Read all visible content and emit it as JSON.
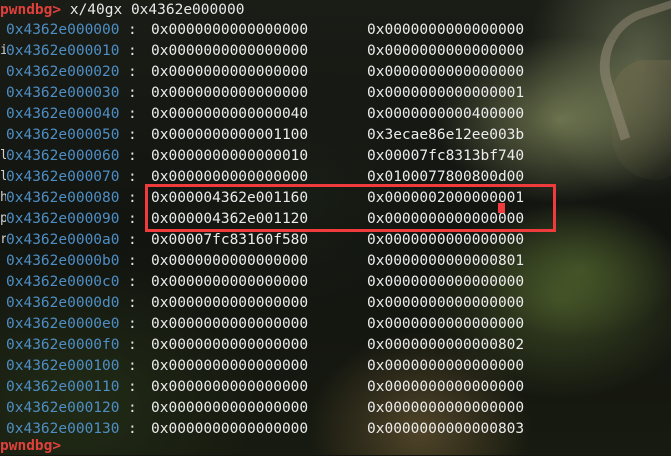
{
  "terminal": {
    "prompt": "pwndbg>",
    "command": "x/40gx 0x4362e000000",
    "final_prompt": "pwndbg>",
    "rows": [
      {
        "addr": "0x4362e000000",
        "v1": "0x0000000000000000",
        "v2": "0x0000000000000000",
        "edge": ""
      },
      {
        "addr": "0x4362e000010",
        "v1": "0x0000000000000000",
        "v2": "0x0000000000000000",
        "edge": "i"
      },
      {
        "addr": "0x4362e000020",
        "v1": "0x0000000000000000",
        "v2": "0x0000000000000000",
        "edge": ""
      },
      {
        "addr": "0x4362e000030",
        "v1": "0x0000000000000000",
        "v2": "0x0000000000000001",
        "edge": ""
      },
      {
        "addr": "0x4362e000040",
        "v1": "0x0000000000000040",
        "v2": "0x0000000000400000",
        "edge": ""
      },
      {
        "addr": "0x4362e000050",
        "v1": "0x0000000000001100",
        "v2": "0x3ecae86e12ee003b",
        "edge": ""
      },
      {
        "addr": "0x4362e000060",
        "v1": "0x0000000000000010",
        "v2": "0x00007fc8313bf740",
        "edge": "l"
      },
      {
        "addr": "0x4362e000070",
        "v1": "0x0000000000000000",
        "v2": "0x0100077800800d00",
        "edge": "l"
      },
      {
        "addr": "0x4362e000080",
        "v1": "0x000004362e001160",
        "v2": "0x0000002000000001",
        "edge": "h"
      },
      {
        "addr": "0x4362e000090",
        "v1": "0x000004362e001120",
        "v2": "0x0000000000000000",
        "edge": "p"
      },
      {
        "addr": "0x4362e0000a0",
        "v1": "0x00007fc83160f580",
        "v2": "0x0000000000000000",
        "edge": "r"
      },
      {
        "addr": "0x4362e0000b0",
        "v1": "0x0000000000000000",
        "v2": "0x0000000000000801",
        "edge": ""
      },
      {
        "addr": "0x4362e0000c0",
        "v1": "0x0000000000000000",
        "v2": "0x0000000000000000",
        "edge": ""
      },
      {
        "addr": "0x4362e0000d0",
        "v1": "0x0000000000000000",
        "v2": "0x0000000000000000",
        "edge": ""
      },
      {
        "addr": "0x4362e0000e0",
        "v1": "0x0000000000000000",
        "v2": "0x0000000000000000",
        "edge": ""
      },
      {
        "addr": "0x4362e0000f0",
        "v1": "0x0000000000000000",
        "v2": "0x0000000000000802",
        "edge": ""
      },
      {
        "addr": "0x4362e000100",
        "v1": "0x0000000000000000",
        "v2": "0x0000000000000000",
        "edge": ""
      },
      {
        "addr": "0x4362e000110",
        "v1": "0x0000000000000000",
        "v2": "0x0000000000000000",
        "edge": ""
      },
      {
        "addr": "0x4362e000120",
        "v1": "0x0000000000000000",
        "v2": "0x0000000000000000",
        "edge": ""
      },
      {
        "addr": "0x4362e000130",
        "v1": "0x0000000000000000",
        "v2": "0x0000000000000803",
        "edge": ""
      }
    ]
  },
  "colors": {
    "prompt": "#e0403c",
    "address": "#4e8ec4",
    "value": "#ececec",
    "highlight_box": "#ef3b3b"
  },
  "icons": {
    "cursor": "block-cursor-icon"
  }
}
